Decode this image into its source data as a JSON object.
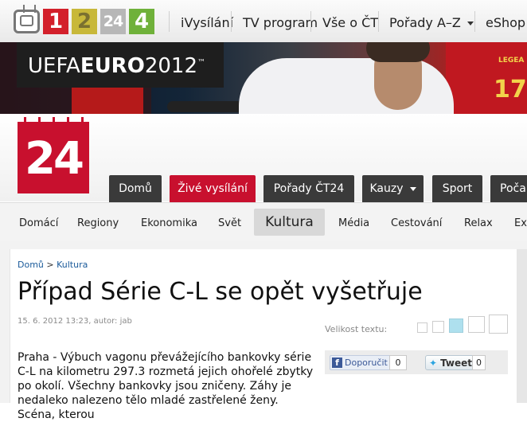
{
  "topbar": {
    "channels": [
      "1",
      "2",
      "24",
      "4"
    ],
    "nav": [
      "iVysílání",
      "TV program",
      "Vše o ČT",
      "Pořady A–Z",
      "eShop"
    ]
  },
  "banner": {
    "brand_light": "UEFA",
    "brand_bold": "EURO",
    "brand_year": "2012",
    "tm": "™",
    "shirt_number": "17",
    "shirt_text": "LEGEA"
  },
  "site": {
    "logo_text": "24",
    "mainnav": [
      "Domů",
      "Živé vysílání",
      "Pořady ČT24",
      "Kauzy",
      "Sport",
      "Poča"
    ]
  },
  "subnav": [
    "Domácí",
    "Regiony",
    "Ekonomika",
    "Svět",
    "Kultura",
    "Média",
    "Cestování",
    "Relax",
    "Ex"
  ],
  "article": {
    "breadcrumb": {
      "home": "Domů",
      "sep": ">",
      "section": "Kultura"
    },
    "title": "Případ Série C-L se opět vyšetřuje",
    "meta": "15. 6. 2012 13:23, autor: jab",
    "font_size_label": "Velikost textu:",
    "share": {
      "facebook_label": "Doporučit",
      "facebook_count": "0",
      "twitter_label": "Tweet",
      "twitter_count": "0"
    },
    "body": "Praha - Výbuch vagonu převážejícího bankovky série C-L na kilometru 297.3 rozmetá jejich ohořelé zbytky po okolí. Všechny bankovky jsou zničeny. Záhy je nedaleko nalezeno tělo mladé zastřelené ženy. Scéna, kterou"
  },
  "colors": {
    "accent": "#c8102e",
    "nav_dark": "#3a3a3a",
    "link": "#1a5a9a"
  }
}
